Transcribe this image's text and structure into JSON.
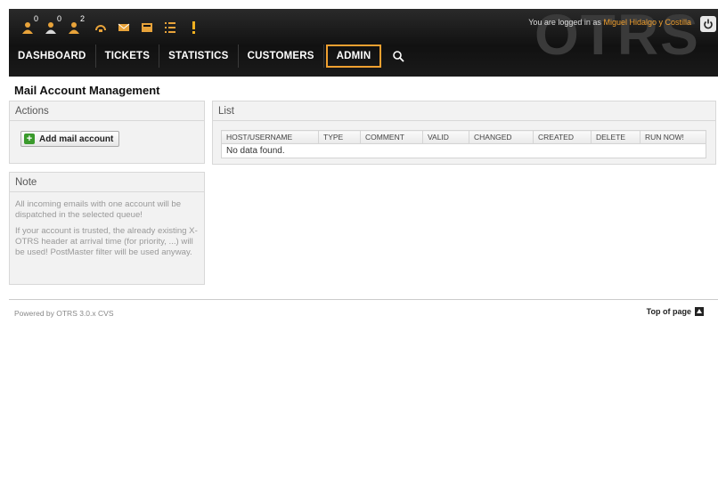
{
  "header": {
    "brand": "OTRS",
    "login_prefix": "You are logged in as",
    "user_name": "Miguel Hidalgo y Costilla",
    "toolbar": [
      {
        "icon": "locked-tickets-icon",
        "count": "0"
      },
      {
        "icon": "watched-tickets-icon",
        "count": "0"
      },
      {
        "icon": "responsible-tickets-icon",
        "count": "2"
      },
      {
        "icon": "new-phone-ticket-icon",
        "count": ""
      },
      {
        "icon": "new-email-ticket-icon",
        "count": ""
      },
      {
        "icon": "ticket-queue-icon",
        "count": ""
      },
      {
        "icon": "status-view-icon",
        "count": ""
      },
      {
        "icon": "escalation-view-icon",
        "count": ""
      }
    ]
  },
  "nav": {
    "dashboard": "DASHBOARD",
    "tickets": "TICKETS",
    "statistics": "STATISTICS",
    "customers": "CUSTOMERS",
    "admin": "ADMIN"
  },
  "page": {
    "title": "Mail Account Management"
  },
  "actions": {
    "title": "Actions",
    "add_button": "Add mail account"
  },
  "note": {
    "title": "Note",
    "paragraph1": "All incoming emails with one account will be dispatched in the selected queue!",
    "paragraph2": "If your account is trusted, the already existing X-OTRS header at arrival time (for priority, ...) will be used! PostMaster filter will be used anyway."
  },
  "list": {
    "title": "List",
    "columns": [
      "HOST/USERNAME",
      "TYPE",
      "COMMENT",
      "VALID",
      "CHANGED",
      "CREATED",
      "DELETE",
      "RUN NOW!"
    ],
    "empty_message": "No data found."
  },
  "footer": {
    "powered_by": "Powered by OTRS 3.0.x CVS",
    "top_of_page": "Top of page"
  },
  "colors": {
    "accent": "#f0a030",
    "header_bg": "#1a1a1a",
    "add_icon": "#3a9a2c"
  }
}
